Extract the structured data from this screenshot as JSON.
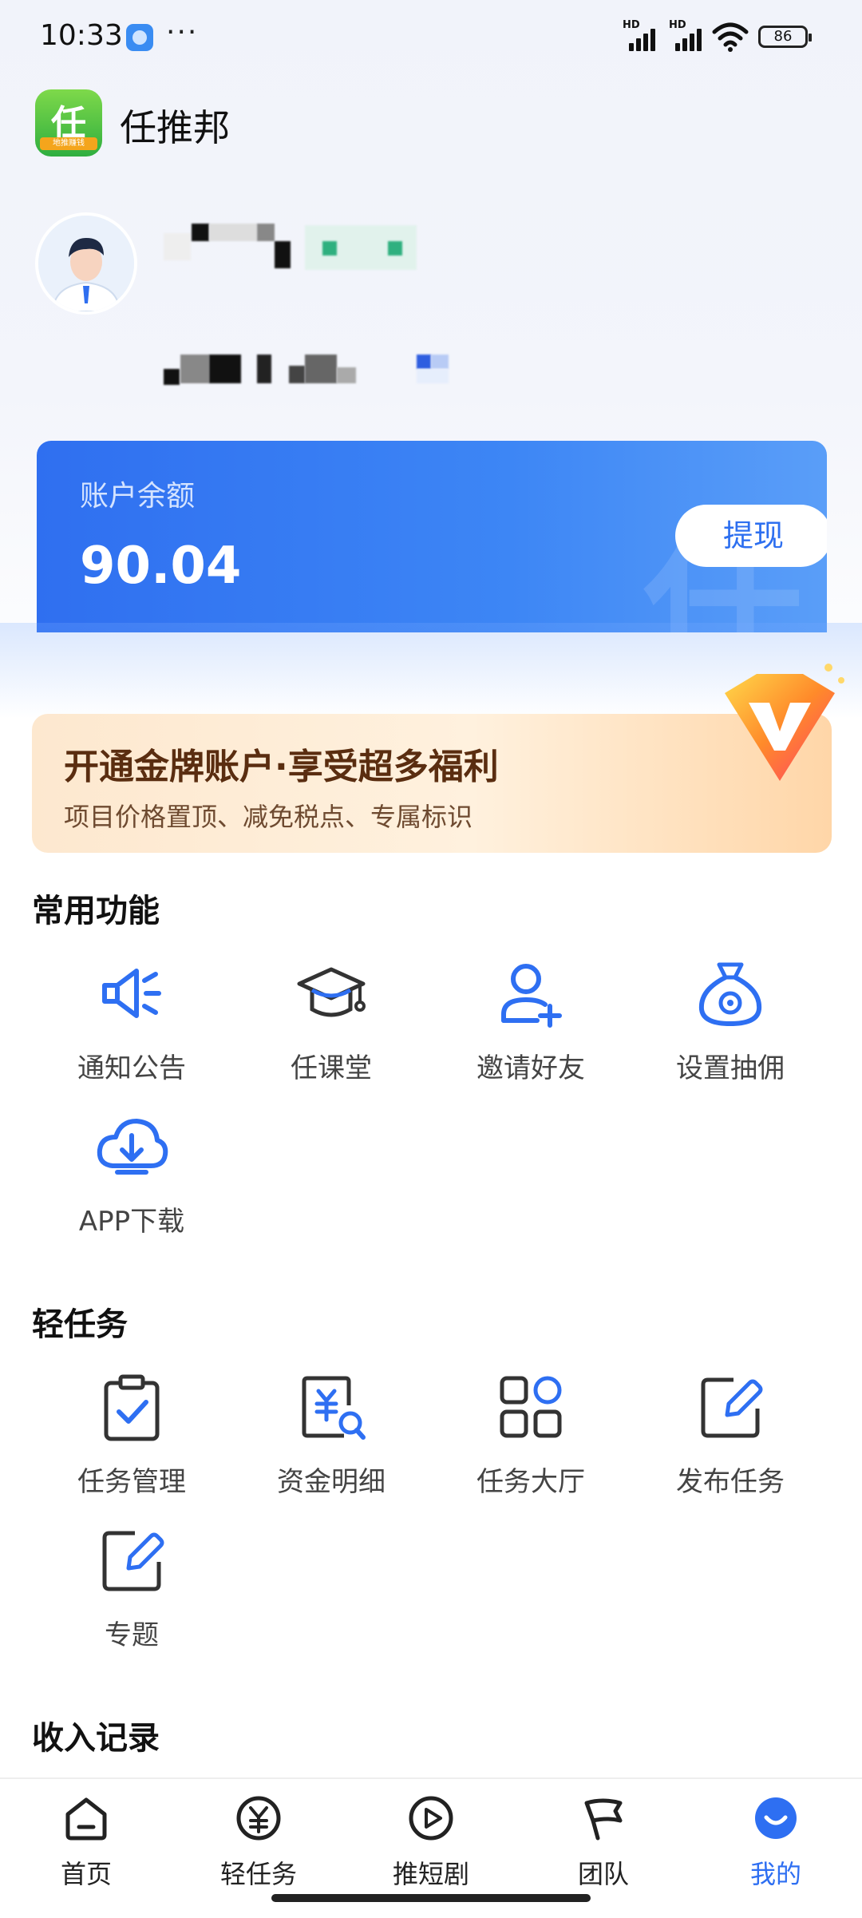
{
  "status_bar": {
    "time": "10:33",
    "battery": "86",
    "more": "···",
    "signal_tag": "HD"
  },
  "header": {
    "app_name": "任推邦",
    "logo_text": "任",
    "logo_tagline": "地推赚钱"
  },
  "balance": {
    "label": "账户余额",
    "value": "90.04",
    "withdraw_label": "提现",
    "watermark": "任"
  },
  "gold_banner": {
    "title": "开通金牌账户·享受超多福利",
    "subtitle": "项目价格置顶、减免税点、专属标识"
  },
  "common_functions": {
    "title": "常用功能",
    "items": [
      {
        "label": "通知公告",
        "icon": "megaphone-icon"
      },
      {
        "label": "任课堂",
        "icon": "graduation-cap-icon"
      },
      {
        "label": "邀请好友",
        "icon": "add-user-icon"
      },
      {
        "label": "设置抽佣",
        "icon": "money-bag-icon"
      },
      {
        "label": "APP下载",
        "icon": "cloud-download-icon"
      }
    ]
  },
  "light_tasks": {
    "title": "轻任务",
    "items": [
      {
        "label": "任务管理",
        "icon": "clipboard-check-icon"
      },
      {
        "label": "资金明细",
        "icon": "yuan-search-icon"
      },
      {
        "label": "任务大厅",
        "icon": "grid-apps-icon"
      },
      {
        "label": "发布任务",
        "icon": "edit-icon"
      },
      {
        "label": "专题",
        "icon": "edit-icon"
      }
    ]
  },
  "income": {
    "title": "收入记录"
  },
  "bottom_nav": {
    "items": [
      {
        "label": "首页",
        "icon": "home-icon"
      },
      {
        "label": "轻任务",
        "icon": "yuan-circle-icon"
      },
      {
        "label": "推短剧",
        "icon": "play-icon"
      },
      {
        "label": "团队",
        "icon": "flag-icon"
      },
      {
        "label": "我的",
        "icon": "profile-icon"
      }
    ],
    "active": "我的"
  },
  "colors": {
    "accent": "#2e6ff2",
    "gold_text": "#5a2d10",
    "logo_green": "#3db845"
  }
}
